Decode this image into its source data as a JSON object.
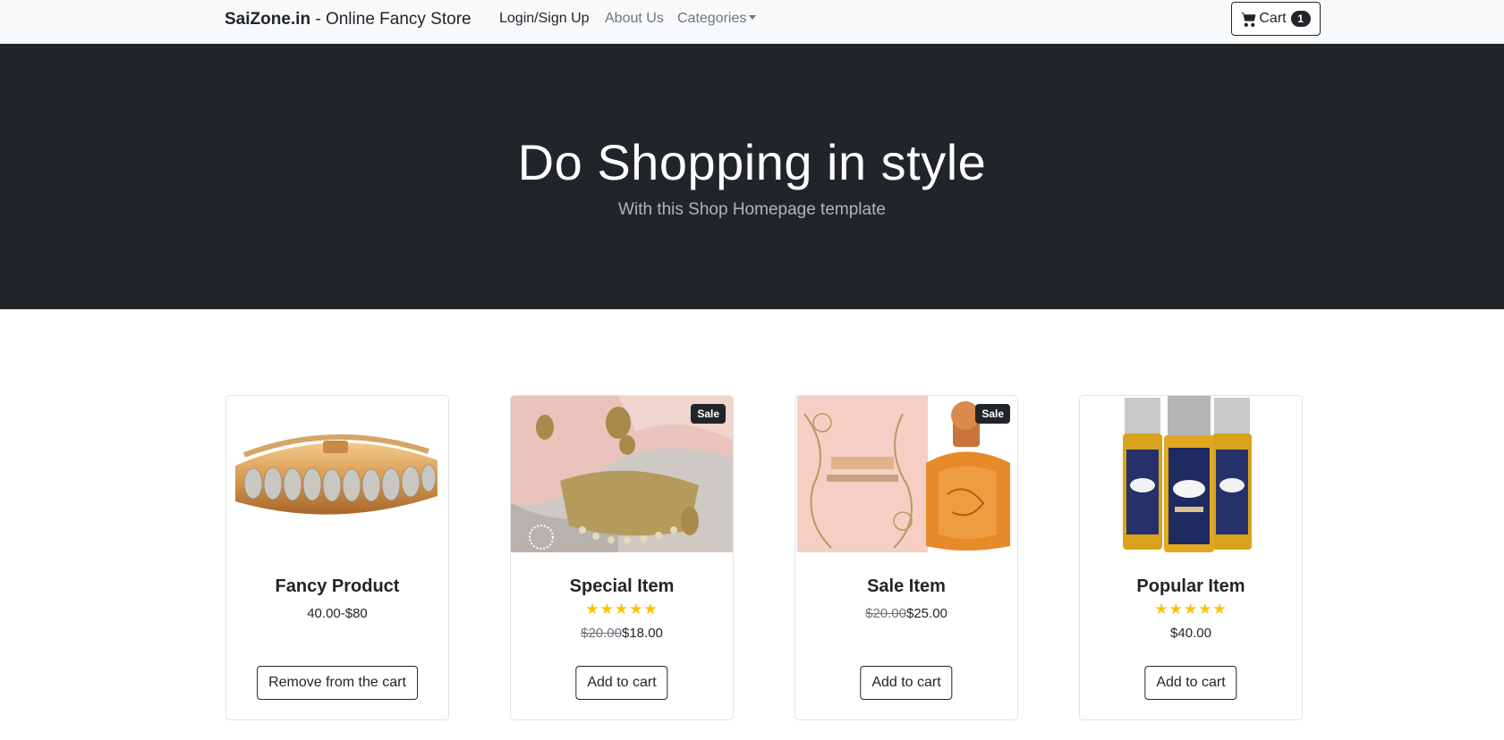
{
  "navbar": {
    "brand_name": "SaiZone.in",
    "brand_tagline": "- Online Fancy Store",
    "links": [
      {
        "label": "Login/Sign Up"
      },
      {
        "label": "About Us"
      },
      {
        "label": "Categories"
      }
    ],
    "cart_label": "Cart",
    "cart_count": "1"
  },
  "hero": {
    "title": "Do Shopping in style",
    "subtitle": "With this Shop Homepage template"
  },
  "products": [
    {
      "title": "Fancy Product",
      "price": "40.00-$80",
      "button": "Remove from the cart",
      "stars": "",
      "sale": "",
      "old_price": ""
    },
    {
      "title": "Special Item",
      "old_price": "$20.00",
      "price": "$18.00",
      "stars": "★★★★★",
      "sale": "Sale",
      "button": "Add to cart"
    },
    {
      "title": "Sale Item",
      "old_price": "$20.00",
      "price": "$25.00",
      "stars": "",
      "sale": "Sale",
      "button": "Add to cart"
    },
    {
      "title": "Popular Item",
      "price": "$40.00",
      "stars": "★★★★★",
      "sale": "",
      "old_price": "",
      "button": "Add to cart"
    }
  ],
  "colors": {
    "navbar_bg": "#f8f9fa",
    "hero_bg": "#212529",
    "star": "#ffc107"
  }
}
